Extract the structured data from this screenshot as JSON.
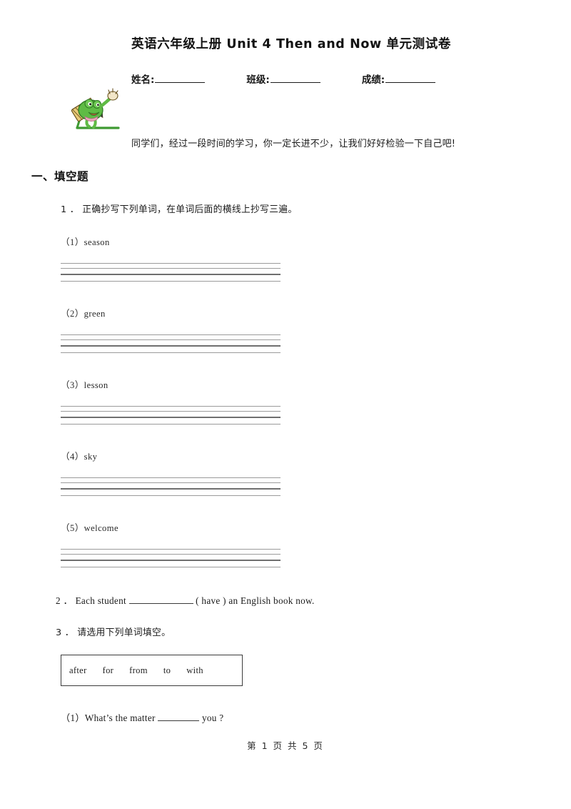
{
  "document": {
    "title": "英语六年级上册 Unit 4 Then and Now 单元测试卷",
    "greeting": "同学们，经过一段时间的学习，你一定长进不少，让我们好好检验一下自己吧!",
    "mascot_icon": "cartoon-pencil-frog-mascot-icon"
  },
  "info_fields": {
    "name_label": "姓名:",
    "class_label": "班级:",
    "score_label": "成绩:"
  },
  "sections": [
    {
      "heading": "一、填空题",
      "questions": [
        {
          "number": "1 .",
          "text": "1 ． 正确抄写下列单词，在单词后面的横线上抄写三遍。",
          "items": [
            {
              "label": "（1）season"
            },
            {
              "label": "（2）green"
            },
            {
              "label": "（3）lesson"
            },
            {
              "label": "（4）sky"
            },
            {
              "label": "（5）welcome"
            }
          ]
        },
        {
          "number": "2 .",
          "text_before": "2 ． Each student",
          "text_after": "( have ) an English book now."
        },
        {
          "number": "3 .",
          "text": "3 ． 请选用下列单词填空。",
          "word_bank": [
            "after",
            "for",
            "from",
            "to",
            "with"
          ],
          "items": [
            {
              "text_before": "（1）What’s the matter",
              "text_after": "you ?"
            }
          ]
        }
      ]
    }
  ],
  "footer": {
    "page_info": "第 1 页 共 5 页"
  },
  "colors": {
    "text": "#1a1a1a",
    "rule_light": "#9b9b9b",
    "rule_dark": "#6f6f6f",
    "mascot_green": "#4aa03c",
    "mascot_hat": "#d9b25a"
  }
}
